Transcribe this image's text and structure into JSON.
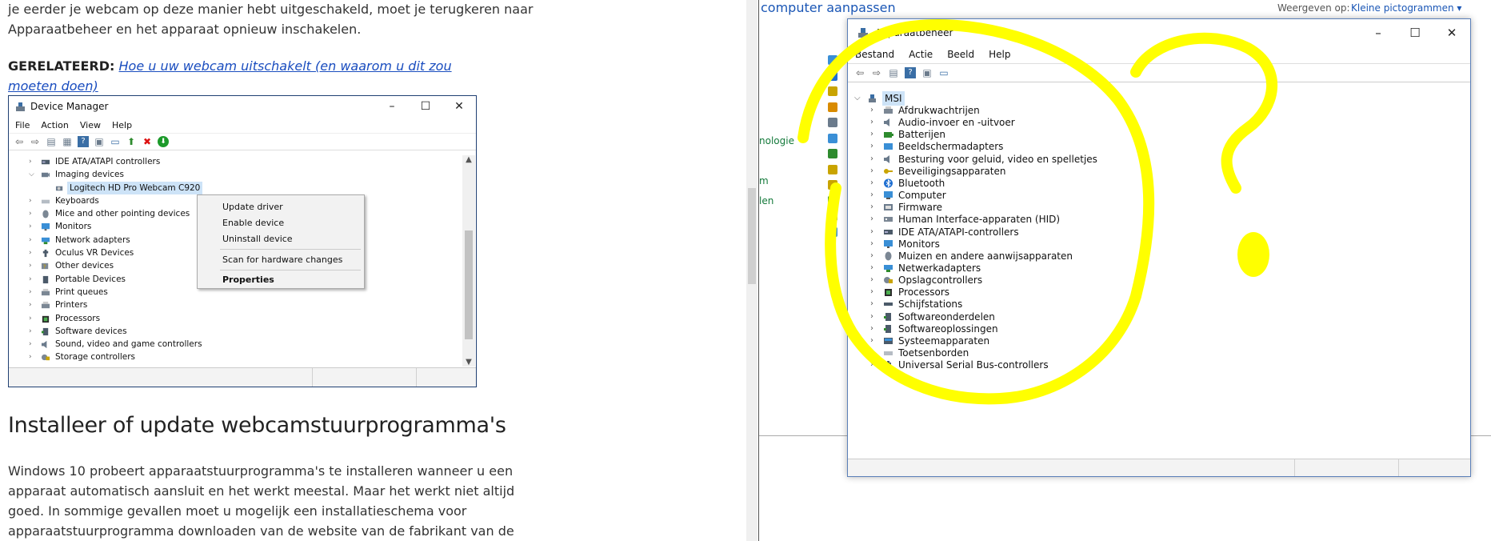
{
  "article": {
    "intro_lines": [
      "je eerder je webcam op deze manier hebt uitgeschakeld, moet je terugkeren naar",
      "Apparaatbeheer en het apparaat opnieuw inschakelen."
    ],
    "related_label": "GERELATEERD:",
    "related_link": "Hoe u uw webcam uitschakelt (en waarom u dit zou moeten doen)",
    "heading": "Installeer of update webcamstuurprogramma's",
    "body_lines": [
      "Windows 10 probeert apparaatstuurprogramma's te installeren wanneer u een",
      "apparaat automatisch aansluit en het werkt meestal. Maar het werkt niet altijd",
      "goed. In sommige gevallen moet u mogelijk een installatieschema voor",
      "apparaatstuurprogramma downloaden van de website van de fabrikant van de"
    ]
  },
  "small_dm": {
    "title": "Device Manager",
    "window_buttons": [
      "–",
      "☐",
      "✕"
    ],
    "menu": [
      "File",
      "Action",
      "View",
      "Help"
    ],
    "items": [
      {
        "label": "IDE ATA/ATAPI controllers",
        "icon": "ide-icon",
        "expanded": false
      },
      {
        "label": "Imaging devices",
        "icon": "camera-icon",
        "expanded": true
      },
      {
        "label": "Logitech HD Pro Webcam C920",
        "icon": "webcam-icon",
        "child": true,
        "selected": true
      },
      {
        "label": "Keyboards",
        "icon": "keyboard-icon",
        "expanded": false
      },
      {
        "label": "Mice and other pointing devices",
        "icon": "mouse-icon",
        "expanded": false
      },
      {
        "label": "Monitors",
        "icon": "monitor-icon",
        "expanded": false
      },
      {
        "label": "Network adapters",
        "icon": "network-icon",
        "expanded": false
      },
      {
        "label": "Oculus VR Devices",
        "icon": "usb-icon",
        "expanded": false
      },
      {
        "label": "Other devices",
        "icon": "unknown-device-icon",
        "expanded": false
      },
      {
        "label": "Portable Devices",
        "icon": "portable-device-icon",
        "expanded": false
      },
      {
        "label": "Print queues",
        "icon": "printer-icon",
        "expanded": false
      },
      {
        "label": "Printers",
        "icon": "printer-icon",
        "expanded": false
      },
      {
        "label": "Processors",
        "icon": "chip-icon",
        "expanded": false
      },
      {
        "label": "Software devices",
        "icon": "software-icon",
        "expanded": false
      },
      {
        "label": "Sound, video and game controllers",
        "icon": "speaker-icon",
        "expanded": false
      },
      {
        "label": "Storage controllers",
        "icon": "storage-icon",
        "expanded": false
      }
    ],
    "context_menu": {
      "update": "Update driver",
      "enable": "Enable device",
      "uninstall": "Uninstall device",
      "scan": "Scan for hardware changes",
      "properties": "Properties"
    }
  },
  "control_panel": {
    "title": "computer aanpassen",
    "view_label": "Weergeven op:",
    "view_value": "Kleine pictogrammen ▾",
    "side_links": [
      "nologie",
      "m",
      "len"
    ]
  },
  "big_dm": {
    "title": "Apparaatbeheer",
    "window_buttons": [
      "–",
      "☐",
      "✕"
    ],
    "menu": [
      "Bestand",
      "Actie",
      "Beeld",
      "Help"
    ],
    "root": "MSI",
    "items": [
      {
        "label": "Afdrukwachtrijen",
        "icon": "printer-icon"
      },
      {
        "label": "Audio-invoer en -uitvoer",
        "icon": "speaker-icon"
      },
      {
        "label": "Batterijen",
        "icon": "battery-icon"
      },
      {
        "label": "Beeldschermadapters",
        "icon": "display-adapter-icon"
      },
      {
        "label": "Besturing voor geluid, video en spelletjes",
        "icon": "speaker-icon"
      },
      {
        "label": "Beveiligingsapparaten",
        "icon": "key-icon"
      },
      {
        "label": "Bluetooth",
        "icon": "bluetooth-icon"
      },
      {
        "label": "Computer",
        "icon": "computer-icon"
      },
      {
        "label": "Firmware",
        "icon": "firmware-icon"
      },
      {
        "label": "Human Interface-apparaten (HID)",
        "icon": "hid-icon"
      },
      {
        "label": "IDE ATA/ATAPI-controllers",
        "icon": "ide-icon"
      },
      {
        "label": "Monitors",
        "icon": "monitor-icon"
      },
      {
        "label": "Muizen en andere aanwijsapparaten",
        "icon": "mouse-icon"
      },
      {
        "label": "Netwerkadapters",
        "icon": "network-icon"
      },
      {
        "label": "Opslagcontrollers",
        "icon": "storage-icon"
      },
      {
        "label": "Processors",
        "icon": "chip-icon"
      },
      {
        "label": "Schijfstations",
        "icon": "disk-icon"
      },
      {
        "label": "Softwareonderdelen",
        "icon": "software-icon"
      },
      {
        "label": "Softwareoplossingen",
        "icon": "software-icon"
      },
      {
        "label": "Systeemapparaten",
        "icon": "system-icon"
      },
      {
        "label": "Toetsenborden",
        "icon": "keyboard-icon"
      },
      {
        "label": "Universal Serial Bus-controllers",
        "icon": "usb-icon"
      }
    ]
  },
  "colors": {
    "annotation": "#ffff00",
    "link": "#1a4dbf",
    "panel_link": "#1a56b5",
    "selection": "#cde3f7"
  }
}
